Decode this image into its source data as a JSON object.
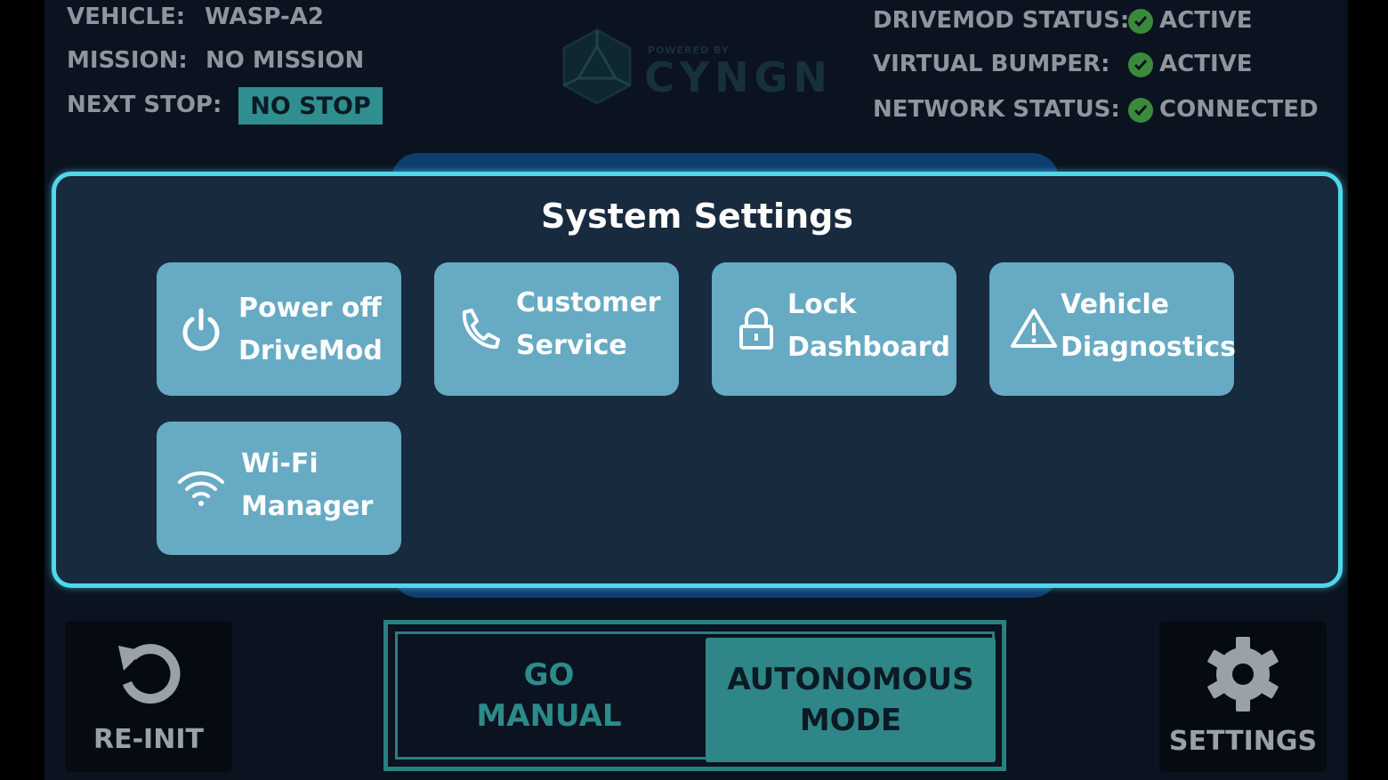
{
  "header": {
    "vehicle_label": "VEHICLE:",
    "vehicle_value": "WASP-A2",
    "mission_label": "MISSION:",
    "mission_value": "NO MISSION",
    "next_stop_label": "NEXT STOP:",
    "next_stop_value": "NO STOP",
    "logo_tagline": "POWERED BY",
    "logo_name": "CYNGN"
  },
  "status": [
    {
      "label": "DRIVEMOD STATUS:",
      "value": "ACTIVE",
      "icon": "check-circle-icon"
    },
    {
      "label": "VIRTUAL BUMPER:",
      "value": "ACTIVE",
      "icon": "check-circle-icon"
    },
    {
      "label": "NETWORK STATUS:",
      "value": "CONNECTED",
      "icon": "check-circle-icon"
    }
  ],
  "dialog": {
    "title": "System Settings",
    "tiles": [
      {
        "line1": "Power off",
        "line2": "DriveMod",
        "icon": "power-icon"
      },
      {
        "line1": "Customer",
        "line2": "Service",
        "icon": "phone-icon"
      },
      {
        "line1": "Lock",
        "line2": "Dashboard",
        "icon": "lock-icon"
      },
      {
        "line1": "Vehicle",
        "line2": "Diagnostics",
        "icon": "warning-icon"
      },
      {
        "line1": "Wi-Fi",
        "line2": "Manager",
        "icon": "wifi-icon"
      }
    ]
  },
  "footer": {
    "reinit_label": "RE-INIT",
    "go_manual_line1": "GO",
    "go_manual_line2": "MANUAL",
    "autonomous_line1": "AUTONOMOUS",
    "autonomous_line2": "MODE",
    "settings_label": "SETTINGS"
  },
  "colors": {
    "accent_cyan": "#4fd8ea",
    "tile_blue": "#67aac4",
    "teal": "#2f8686",
    "status_green": "#3b8a3b"
  }
}
